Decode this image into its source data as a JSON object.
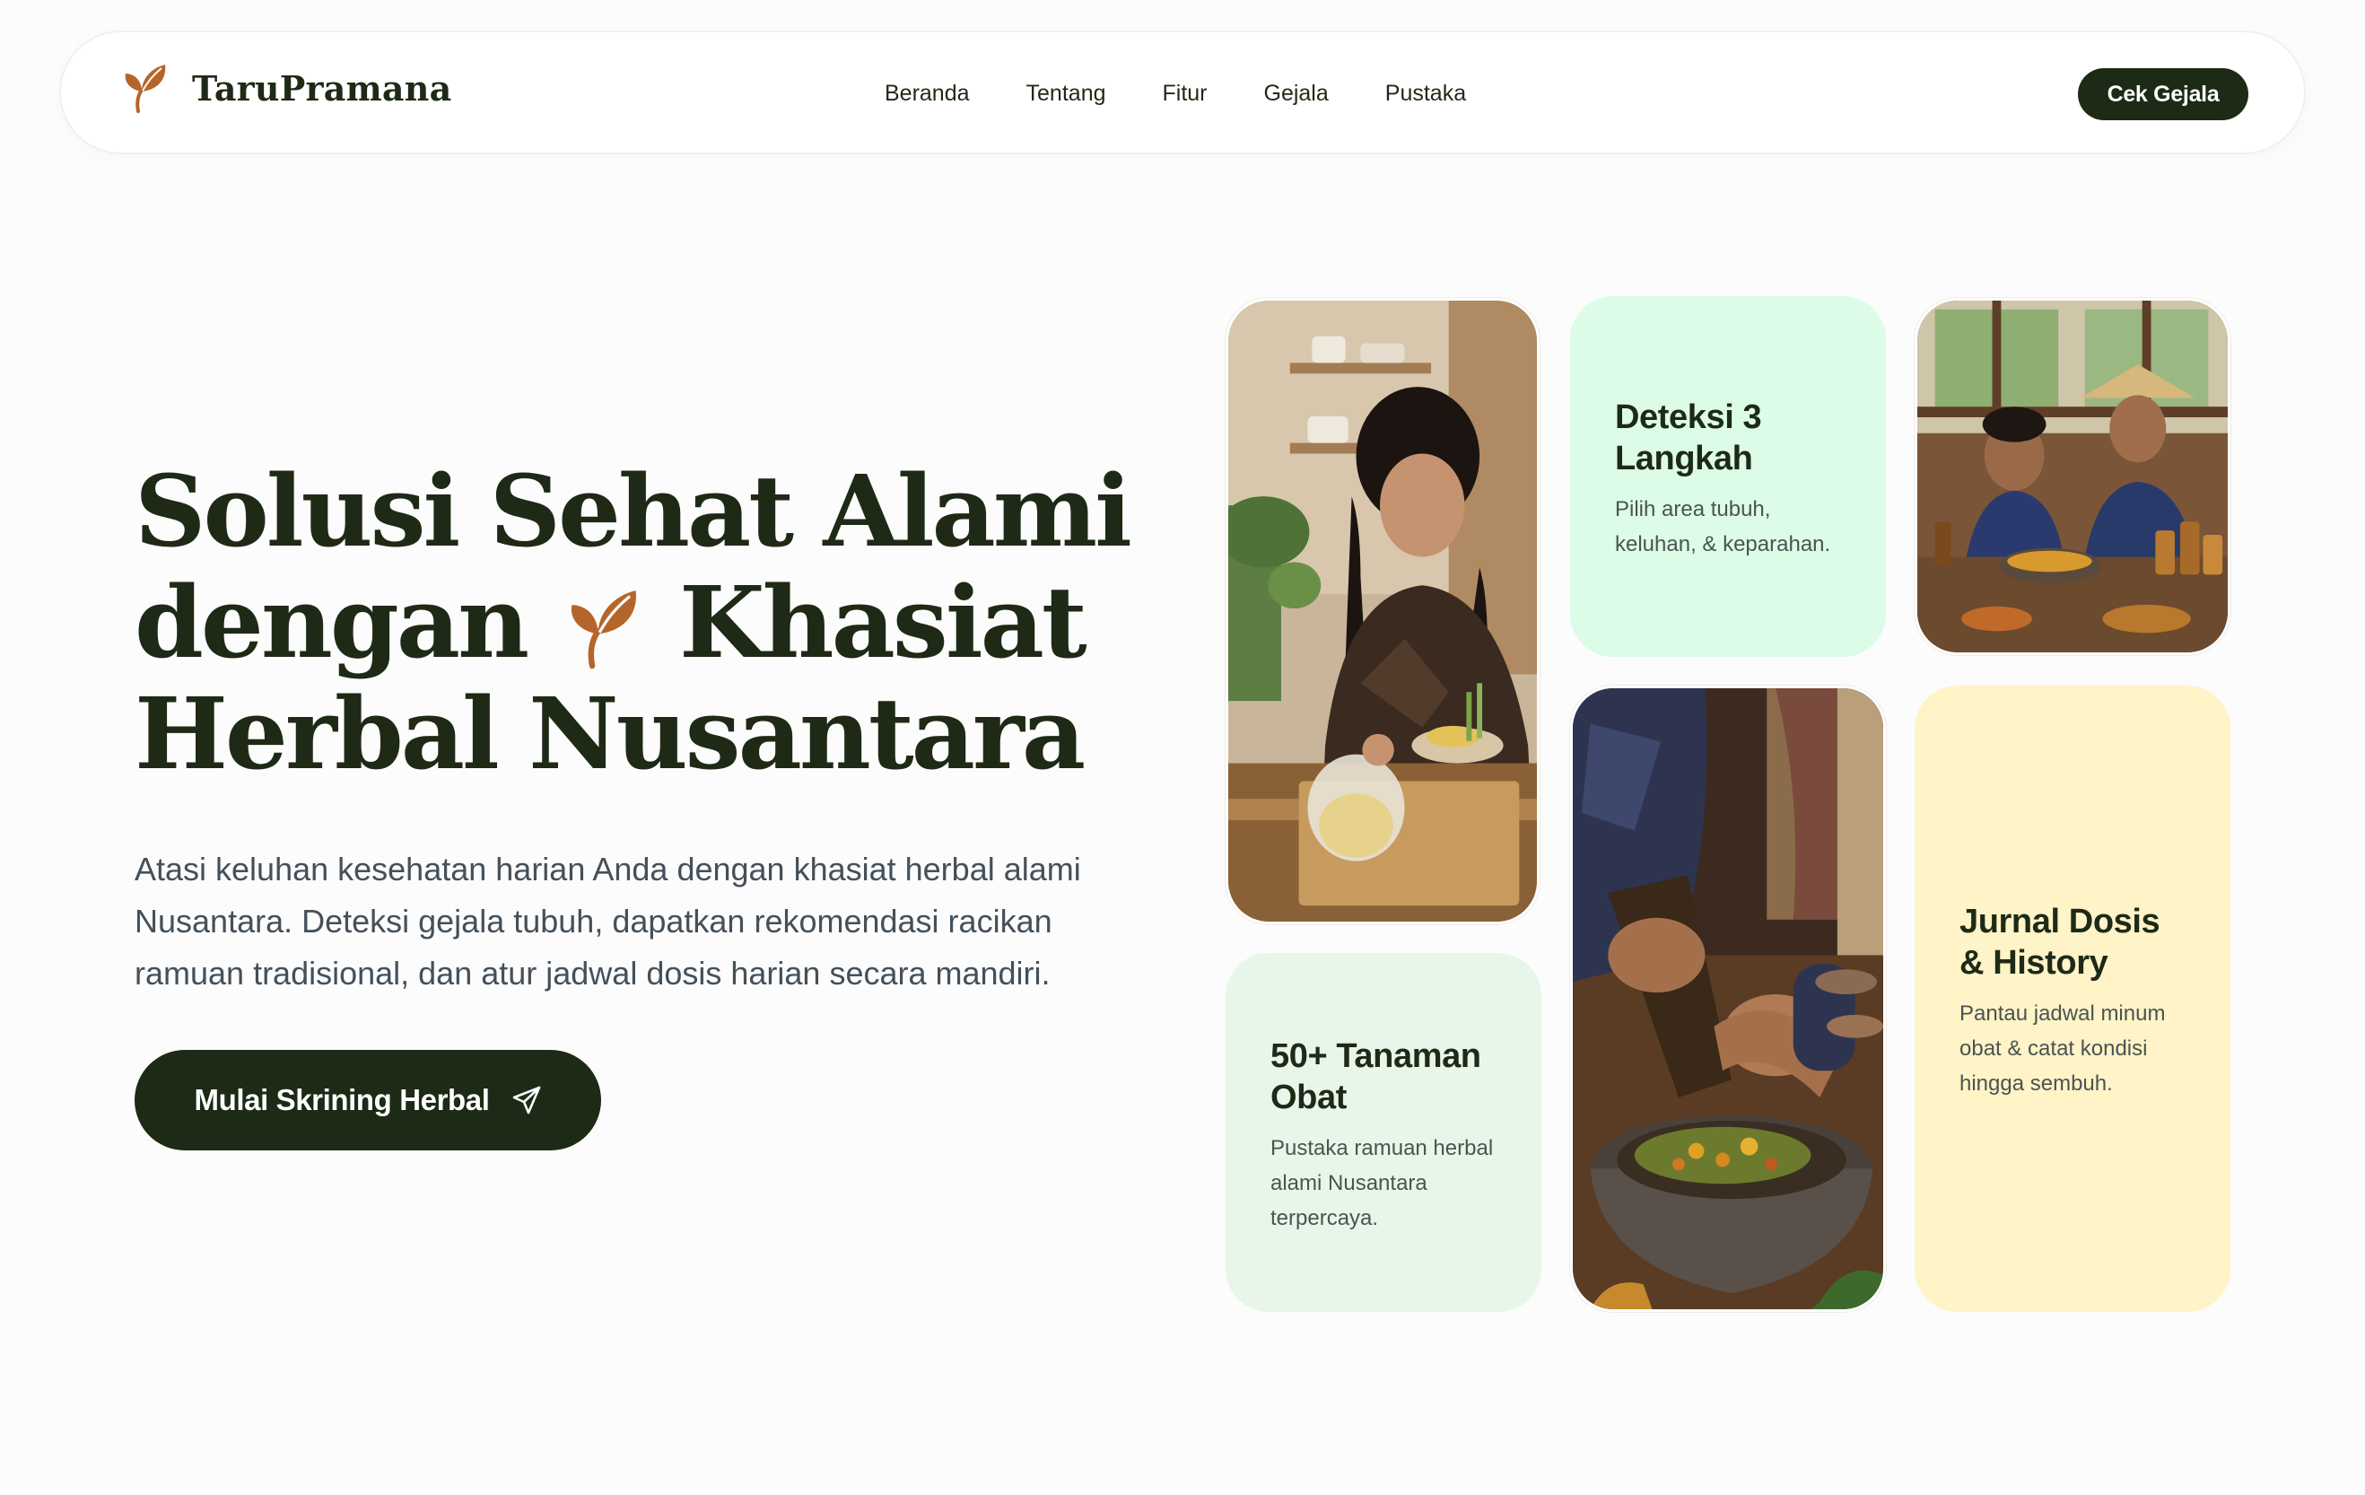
{
  "brand": {
    "name": "TaruPramana",
    "logo_icon": "leaf-icon",
    "accent_color": "#b5652a"
  },
  "nav": {
    "links": [
      "Beranda",
      "Tentang",
      "Fitur",
      "Gejala",
      "Pustaka"
    ],
    "cta_label": "Cek Gejala"
  },
  "hero": {
    "title_line1": "Solusi Sehat Alami",
    "title_line2_pre": "dengan",
    "title_line2_post": "Khasiat",
    "title_line3": "Herbal Nusantara",
    "description": "Atasi keluhan kesehatan harian Anda dengan khasiat herbal alami Nusantara. Deteksi gejala tubuh, dapatkan rekomendasi racikan ramuan tradisional, dan atur jadwal dosis harian secara mandiri.",
    "button_label": "Mulai Skrining Herbal",
    "button_icon": "send-icon"
  },
  "cards": {
    "deteksi": {
      "title": "Deteksi 3 Langkah",
      "text": "Pilih area tubuh, keluhan, & keparahan."
    },
    "tanaman": {
      "title": "50+ Tanaman Obat",
      "text": "Pustaka ramuan herbal alami Nusantara terpercaya."
    },
    "jurnal": {
      "title": "Jurnal Dosis & History",
      "text": "Pantau jadwal minum obat & catat kondisi hingga sembuh."
    }
  },
  "colors": {
    "dark": "#1c2a16",
    "mint": "#dcfce7",
    "pale_green": "#e8f6ea",
    "cream": "#fff3c8"
  }
}
